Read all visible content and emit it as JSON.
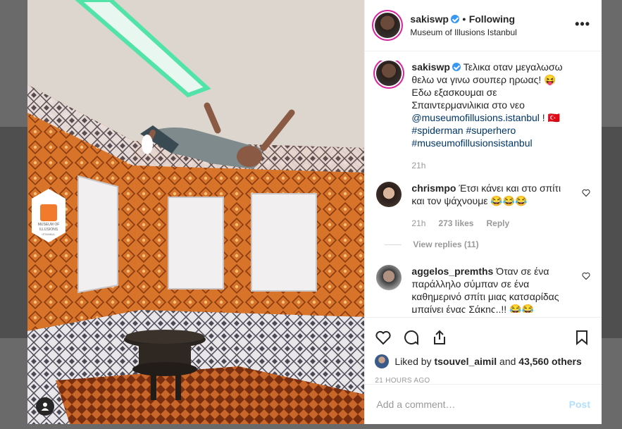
{
  "header": {
    "username": "sakiswp",
    "separator": "•",
    "follow_status": "Following",
    "location": "Museum of Illusions Istanbul",
    "more": "•••"
  },
  "photo": {
    "sign_line1": "MUSEUM OF",
    "sign_line2": "ILLUSIONS",
    "sign_line3": "ISTANBUL"
  },
  "caption": {
    "username": "sakiswp",
    "text1": "Τελικα οταν μεγαλωσω θελω να γινω σουπερ ηρωας! 😝 Εδω εξασκουμαι σε Σπαιντερμανιλικια στο νεο ",
    "mention": "@museumofillusions.istanbul",
    "text2": " ! 🇹🇷",
    "hashtags": "#spiderman #superhero #museumofillusionsistanbul",
    "time": "21h"
  },
  "comments": [
    {
      "username": "chrismpo",
      "text": "Έτσι κάνει και στο σπίτι και τον ψάχνουμε 😂😂😂",
      "time": "21h",
      "likes": "273 likes",
      "reply": "Reply",
      "view_replies": "View replies (11)"
    },
    {
      "username": "aggelos_premths",
      "text": "Όταν σε ένα παράλληλο σύμπαν σε ένα καθημερινό σπίτι μιας κατσαρίδας μπαίνει ένας Σάκης..!! 😂😂"
    }
  ],
  "actions": {
    "liked_by_prefix": "Liked by",
    "liked_by_user": "tsouvel_aimil",
    "and": "and",
    "others": "43,560 others",
    "time_ago": "21 HOURS AGO"
  },
  "add_comment": {
    "placeholder": "Add a comment…",
    "post": "Post"
  },
  "colors": {
    "accent": "#3897f0",
    "post_disabled": "#b2dffc",
    "pattern_orange": "#e07a2a"
  }
}
